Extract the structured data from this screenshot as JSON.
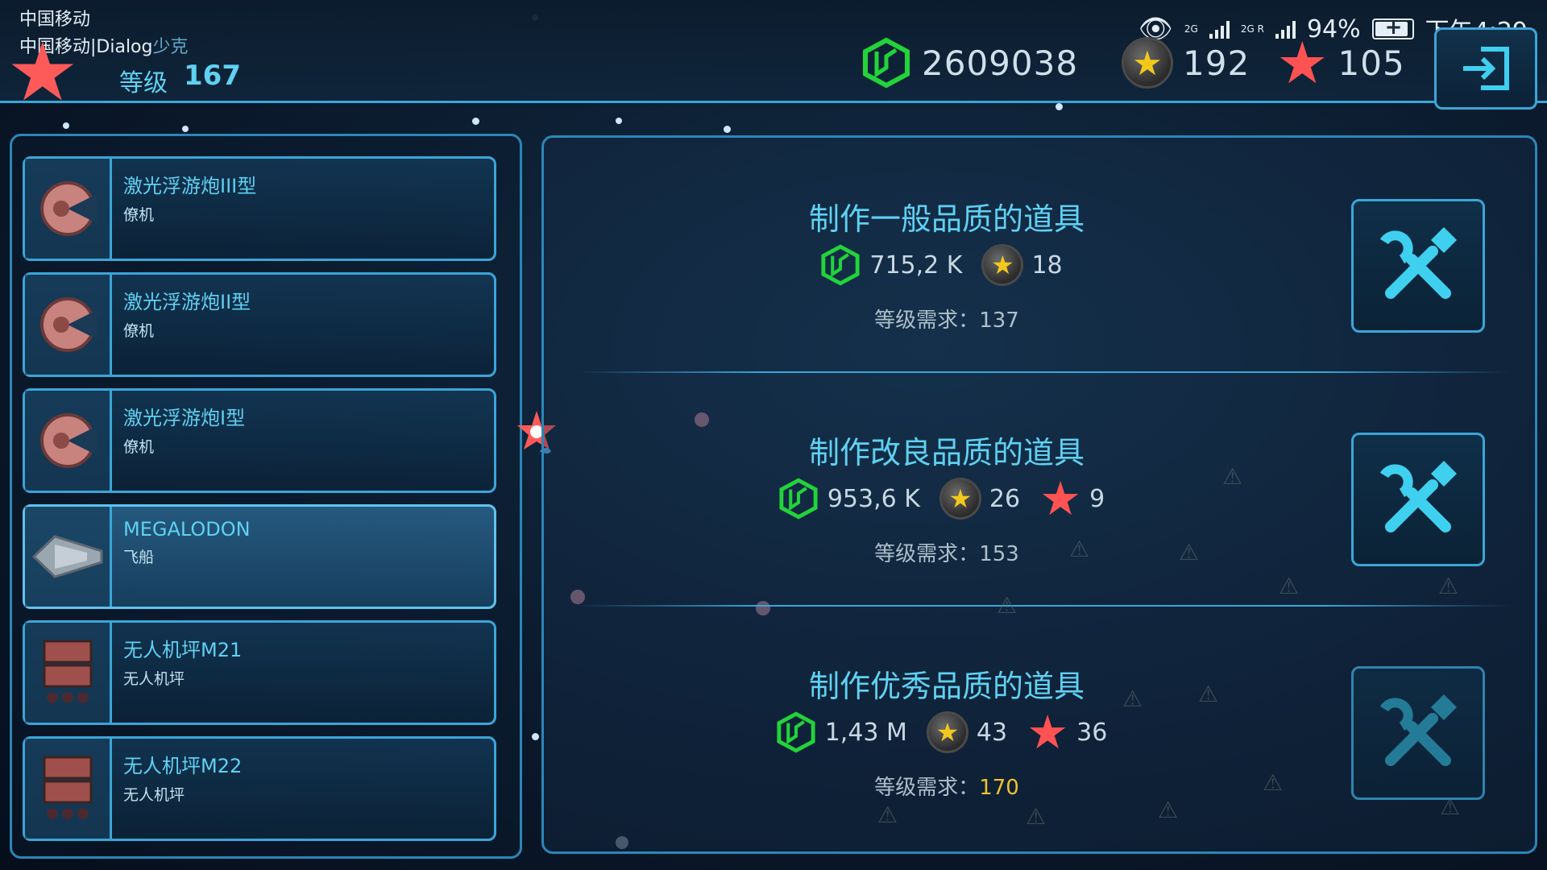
{
  "status_bar": {
    "carrier_1": "中国移动",
    "carrier_2": "中国移动|Dialog",
    "carrier_2_ghost": "少克",
    "network_1": "2G",
    "network_2": "2G R",
    "battery": "94%",
    "time": "下午4:29"
  },
  "header": {
    "level_label": "等级",
    "level_value": "167",
    "currency_green": "2609038",
    "currency_gold": "192",
    "currency_red": "105"
  },
  "items": [
    {
      "name": "激光浮游炮III型",
      "type": "僚机",
      "thumb": "laser-drone-icon"
    },
    {
      "name": "激光浮游炮II型",
      "type": "僚机",
      "thumb": "laser-drone-icon"
    },
    {
      "name": "激光浮游炮I型",
      "type": "僚机",
      "thumb": "laser-drone-icon"
    },
    {
      "name": "MEGALODON",
      "type": "飞船",
      "thumb": "spaceship-icon"
    },
    {
      "name": "无人机坪M21",
      "type": "无人机坪",
      "thumb": "drone-bay-icon"
    },
    {
      "name": "无人机坪M22",
      "type": "无人机坪",
      "thumb": "drone-bay-icon"
    }
  ],
  "recipes": [
    {
      "title": "制作一般品质的道具",
      "green": "715,2 K",
      "gold": "18",
      "red": "",
      "req_label": "等级需求：",
      "req_value": "137"
    },
    {
      "title": "制作改良品质的道具",
      "green": "953,6 K",
      "gold": "26",
      "red": "9",
      "req_label": "等级需求：",
      "req_value": "153"
    },
    {
      "title": "制作优秀品质的道具",
      "green": "1,43 M",
      "gold": "43",
      "red": "36",
      "req_label": "等级需求：",
      "req_value": "170"
    }
  ],
  "colors": {
    "accent": "#3aa6d8",
    "title_cyan": "#5fd1f2",
    "warning_yellow": "#f2c22c",
    "red_star": "#ff5252",
    "green_cube": "#22d33a"
  }
}
